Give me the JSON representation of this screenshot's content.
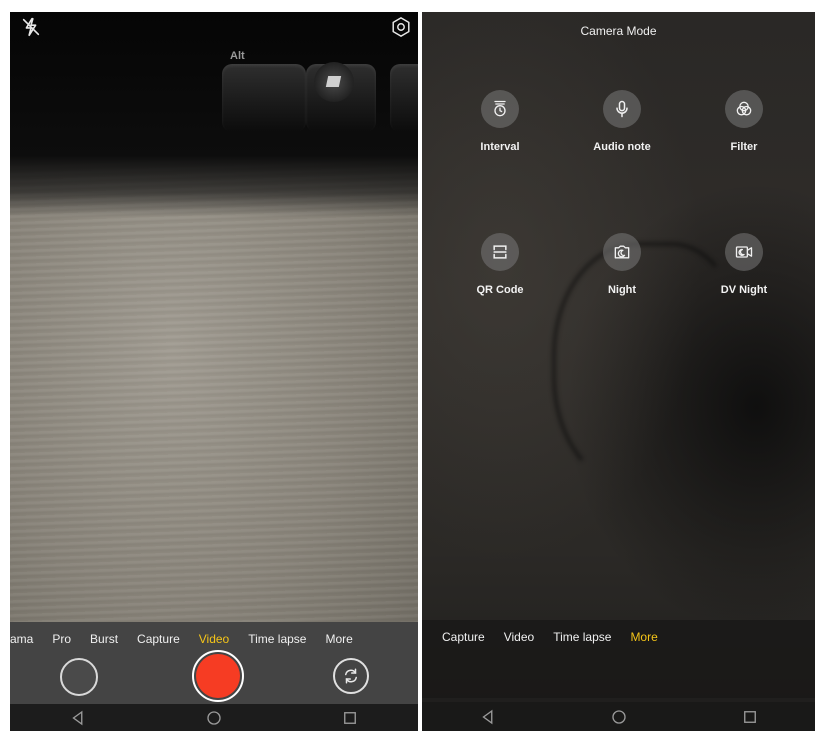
{
  "left_screen": {
    "keyboard": {
      "key_label": "Alt"
    },
    "top_icons": {
      "flash": "flash-off-icon",
      "settings": "settings-hex-icon"
    },
    "modes": [
      {
        "label": "rama",
        "active": false
      },
      {
        "label": "Pro",
        "active": false
      },
      {
        "label": "Burst",
        "active": false
      },
      {
        "label": "Capture",
        "active": false
      },
      {
        "label": "Video",
        "active": true
      },
      {
        "label": "Time lapse",
        "active": false
      },
      {
        "label": "More",
        "active": false
      }
    ],
    "colors": {
      "shutter": "#f63c23",
      "active_mode": "#f5c518"
    }
  },
  "right_screen": {
    "title": "Camera Mode",
    "tiles": [
      {
        "label": "Interval",
        "icon": "interval-timer-icon"
      },
      {
        "label": "Audio note",
        "icon": "microphone-icon"
      },
      {
        "label": "Filter",
        "icon": "filter-circles-icon"
      },
      {
        "label": "QR Code",
        "icon": "qr-scan-icon"
      },
      {
        "label": "Night",
        "icon": "night-camera-icon"
      },
      {
        "label": "DV Night",
        "icon": "dv-night-icon"
      }
    ],
    "modes": [
      {
        "label": "Capture",
        "active": false
      },
      {
        "label": "Video",
        "active": false
      },
      {
        "label": "Time lapse",
        "active": false
      },
      {
        "label": "More",
        "active": true
      }
    ]
  },
  "navbar": {
    "back": "back-triangle-icon",
    "home": "home-circle-icon",
    "recents": "recents-square-icon"
  }
}
